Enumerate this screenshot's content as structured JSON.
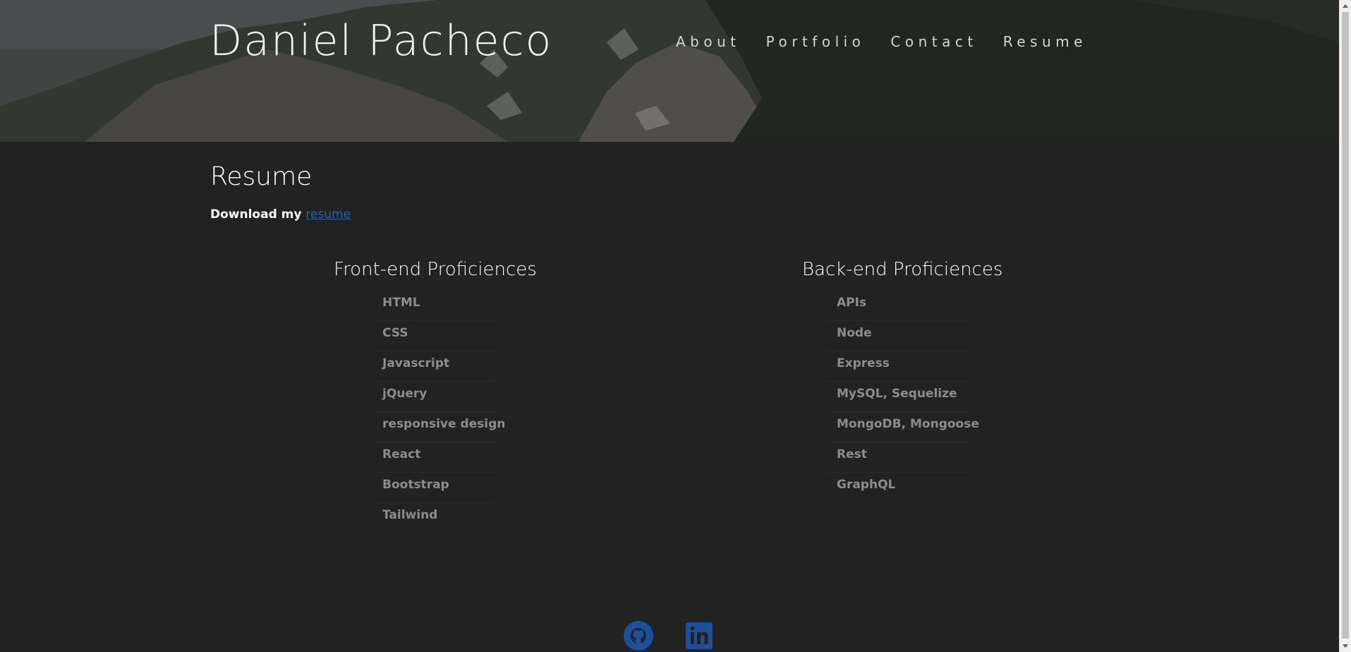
{
  "header": {
    "title": "Daniel Pacheco",
    "nav": [
      {
        "label": "About"
      },
      {
        "label": "Portfolio"
      },
      {
        "label": "Contact"
      },
      {
        "label": "Resume"
      }
    ]
  },
  "main": {
    "section_title": "Resume",
    "download_text": "Download my ",
    "download_link": "resume",
    "columns": [
      {
        "heading": "Front-end Proficiences",
        "items": [
          "HTML",
          "CSS",
          "Javascript",
          "jQuery",
          "responsive design",
          "React",
          "Bootstrap",
          "Tailwind"
        ]
      },
      {
        "heading": "Back-end Proficiences",
        "items": [
          "APIs",
          "Node",
          "Express",
          "MySQL, Sequelize",
          "MongoDB, Mongoose",
          "Rest",
          "GraphQL"
        ]
      }
    ]
  },
  "footer": {
    "icons": [
      "github-icon",
      "linkedin-icon"
    ]
  },
  "colors": {
    "background": "#222222",
    "link": "#2a5ea8",
    "icon": "#1e4f9c",
    "item_text": "#8c8c8c"
  }
}
